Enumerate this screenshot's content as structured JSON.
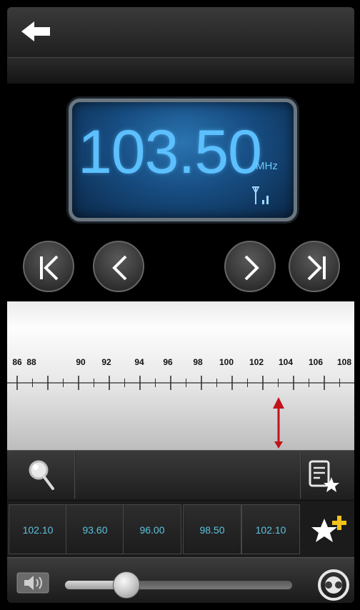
{
  "display": {
    "frequency": "103.50",
    "unit": "MHz"
  },
  "scale": {
    "labels": [
      "86",
      "88",
      "90",
      "92",
      "94",
      "96",
      "98",
      "100",
      "102",
      "104",
      "106",
      "108"
    ]
  },
  "presets": [
    "102.10",
    "93.60",
    "96.00",
    "98.50",
    "102.10"
  ],
  "volume": {
    "level": 0.27
  },
  "colors": {
    "frequency_text": "#5cc0ff",
    "preset_text": "#5cc3de",
    "tuner_marker": "#c0141a",
    "display_bg": "#174d82"
  },
  "icons": {
    "back": "back-arrow-icon",
    "first": "skip-to-start-icon",
    "prev": "chevron-left-icon",
    "next": "chevron-right-icon",
    "last": "skip-to-end-icon",
    "search": "search-icon",
    "list": "favorites-list-icon",
    "add_fav": "add-favorite-icon",
    "speaker": "speaker-icon",
    "output": "audio-output-icon",
    "signal": "signal-strength-icon"
  }
}
